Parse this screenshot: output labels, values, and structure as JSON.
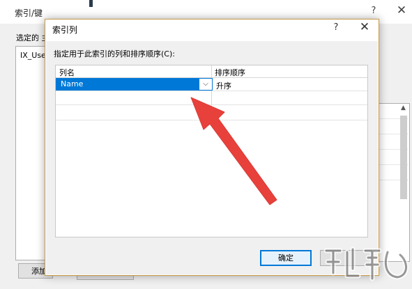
{
  "background_window": {
    "title": "索引/键",
    "help_glyph": "?",
    "close_glyph": "✕",
    "selected_label": "选定的 主",
    "list_item": "IX_Use",
    "add_button_label": "添加"
  },
  "dialog": {
    "title": "索引列",
    "help_glyph": "?",
    "close_glyph": "✕",
    "instruction": "指定用于此索引的列和排序顺序(C):",
    "grid": {
      "headers": [
        "列名",
        "排序顺序"
      ],
      "rows": [
        {
          "column": "Name",
          "order": "升序"
        }
      ]
    },
    "dropdown_arrow_glyph": "⌵",
    "ok_label": "确定"
  },
  "annotation": {
    "arrow_color": "#e8413c"
  },
  "colors": {
    "selection": "#0078d7",
    "dialog_border": "#c79a4a"
  }
}
